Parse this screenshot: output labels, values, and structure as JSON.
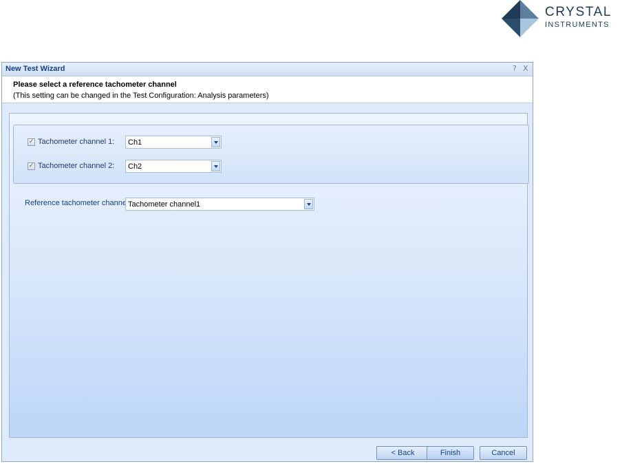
{
  "logo": {
    "line1": "CRYSTAL",
    "line2": "INSTRUMENTS",
    "colors": {
      "dark": "#1f3b57",
      "light": "#8fb5d4"
    }
  },
  "dialog": {
    "title": "New Test Wizard",
    "help_label": "?",
    "close_label": "X",
    "header": {
      "title": "Please select a reference tachometer channel",
      "subtitle": "(This setting can be changed in the Test Configuration: Analysis parameters)"
    },
    "tachometers": [
      {
        "label": "Tachometer  channel 1:",
        "checked": true,
        "value": "Ch1"
      },
      {
        "label": "Tachometer  channel 2:",
        "checked": true,
        "value": "Ch2"
      }
    ],
    "reference": {
      "label": "Reference tachometer channel",
      "value": "Tachometer channel1"
    },
    "buttons": {
      "back": "< Back",
      "finish": "Finish",
      "cancel": "Cancel"
    }
  }
}
